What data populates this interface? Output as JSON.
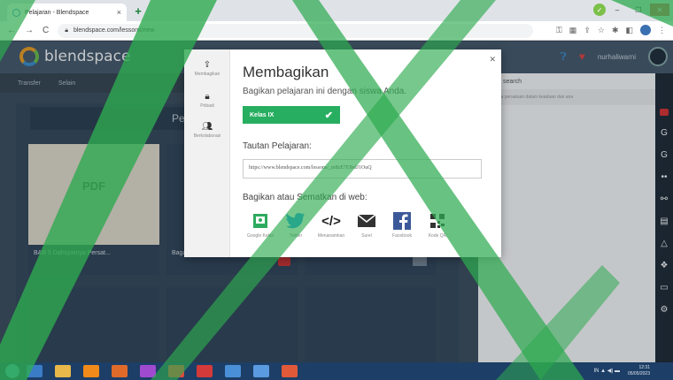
{
  "browser": {
    "tab_title": "Pelajaran - Blendspace",
    "tab_close": "×",
    "new_tab": "+",
    "window_title": "",
    "url": "blendspace.com/lessons/new",
    "ctrl_min": "–",
    "ctrl_max": "❐",
    "ctrl_close": "✕"
  },
  "app": {
    "logo_text": "blendspace",
    "user_name": "nurhaliwarni",
    "subnav": [
      "Transfer",
      "Selain"
    ],
    "board_title": "Pe",
    "cards": [
      {
        "type": "PDF",
        "caption": "BAB 5 Dahsyatnya Persat..."
      },
      {
        "caption": "Bagaimana ..."
      },
      {
        "caption": ""
      }
    ],
    "search_label": "search",
    "search_placeholder": "pentingnya persatuan dalam keadaan dan ana",
    "search_button": "🔍"
  },
  "modal": {
    "sidebar": [
      {
        "icon": "share-icon",
        "label": "Membagikan"
      },
      {
        "icon": "lock-icon",
        "label": "Pribadi"
      },
      {
        "icon": "collaborate-icon",
        "label": "Berkolaborasi"
      }
    ],
    "close": "✕",
    "title": "Membagikan",
    "subtitle": "Bagikan pelajaran ini dengan siswa Anda.",
    "class_button": "Kelas IX",
    "class_check": "✔",
    "link_label": "Tautan Pelajaran:",
    "link_value": "https://www.blendspace.com/lessons/_m8zE7E8rdJ1OuQ",
    "share_label": "Bagikan atau Sematkan di web:",
    "share_items": [
      {
        "icon": "google-classroom-icon",
        "label": "Google Kelas",
        "color": "#2eaa5f"
      },
      {
        "icon": "twitter-icon",
        "label": "Twitter",
        "color": "#1da1f2"
      },
      {
        "icon": "embed-icon",
        "label": "Menanamkan",
        "color": "#222222"
      },
      {
        "icon": "mail-icon",
        "label": "Surel",
        "color": "#333333"
      },
      {
        "icon": "facebook-icon",
        "label": "Facebook",
        "color": "#3b5998"
      },
      {
        "icon": "qr-code-icon",
        "label": "Kode QR",
        "color": "#333333"
      }
    ]
  },
  "taskbar": {
    "time": "12:31",
    "date": "05/05/2023",
    "tray_text": "IN ▲ ◀) ▬"
  },
  "colors": {
    "accent_green": "#27ae60",
    "app_header": "#46596b",
    "taskbar": "#1d3e66"
  }
}
